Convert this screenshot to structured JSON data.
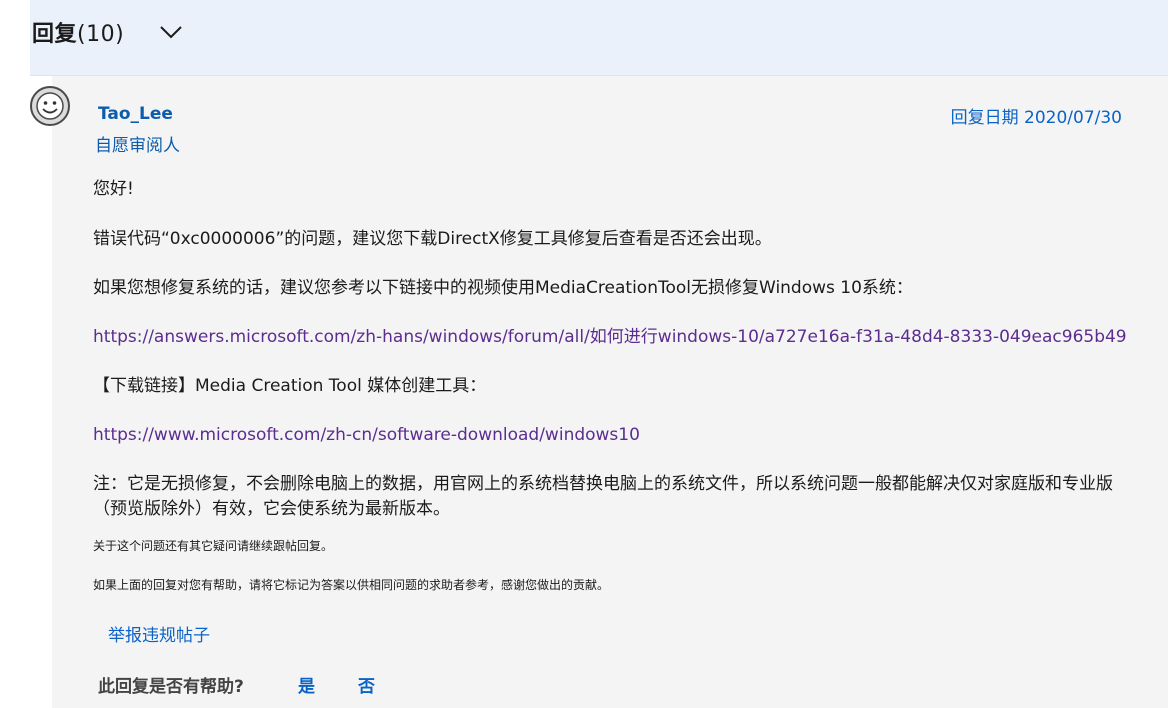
{
  "header": {
    "title": "回复",
    "count": "(10)"
  },
  "reply": {
    "author": "Tao_Lee",
    "role": "自愿审阅人",
    "date": "回复日期 2020/07/30",
    "greeting": "您好!",
    "para1": "错误代码“0xc0000006”的问题，建议您下载DirectX修复工具修复后查看是否还会出现。",
    "para2": "如果您想修复系统的话，建议您参考以下链接中的视频使用MediaCreationTool无损修复Windows 10系统：",
    "link1": "https://answers.microsoft.com/zh-hans/windows/forum/all/如何进行windows-10/a727e16a-f31a-48d4-8333-049eac965b49",
    "para3": "【下载链接】Media Creation Tool 媒体创建工具：",
    "link2": "https://www.microsoft.com/zh-cn/software-download/windows10",
    "note": "注：它是无损修复，不会删除电脑上的数据，用官网上的系统档替换电脑上的系统文件，所以系统问题一般都能解决仅对家庭版和专业版（预览版除外）有效，它会使系统为最新版本。",
    "small1": "关于这个问题还有其它疑问请继续跟帖回复。",
    "small2": "如果上面的回复对您有帮助，请将它标记为答案以供相同问题的求助者参考，感谢您做出的贡献。",
    "report": "举报违规帖子",
    "helpful_question": "此回复是否有帮助?",
    "yes": "是",
    "no": "否"
  },
  "icons": {
    "expand": "chevron-down-icon",
    "avatar": "smiley-avatar-icon"
  },
  "colors": {
    "header_bg": "#eaf1fa",
    "card_bg": "#f4f4f4",
    "accent_blue": "#0b63c7",
    "visited_link": "#5c2d91"
  }
}
